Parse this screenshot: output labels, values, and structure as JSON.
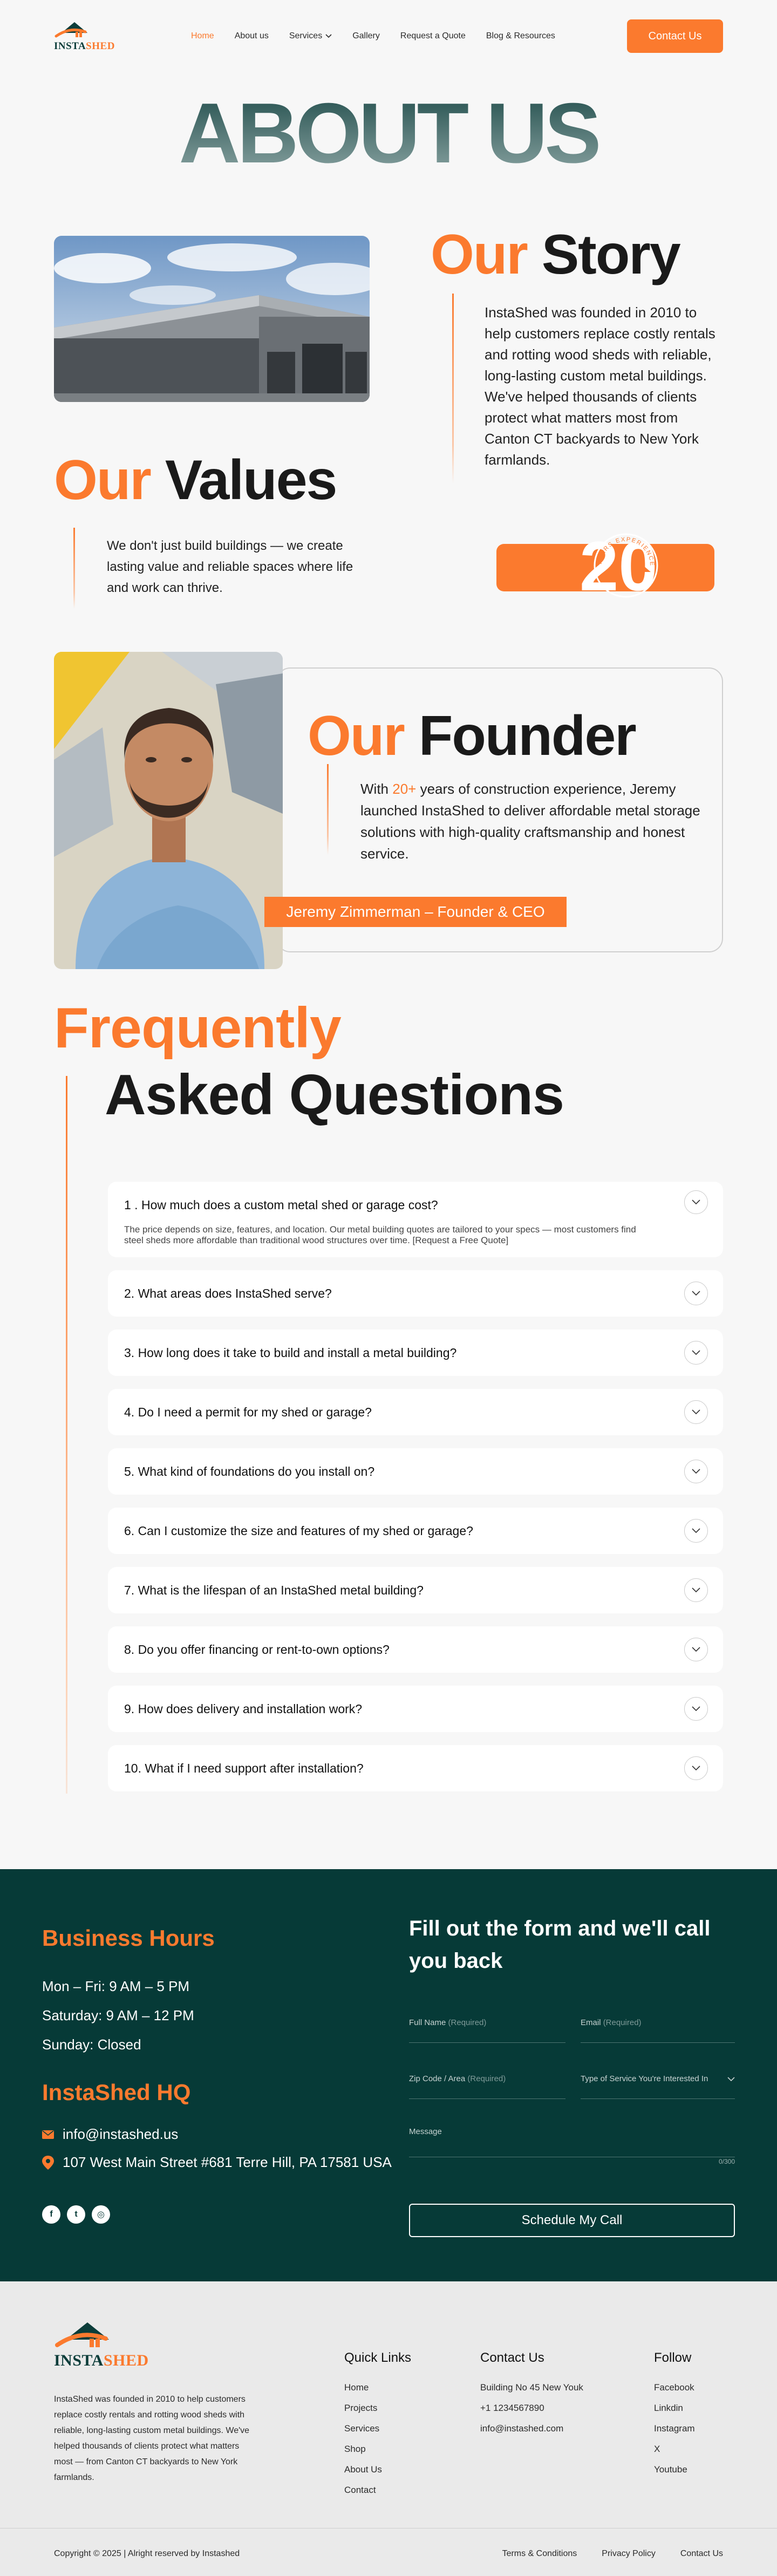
{
  "brand": {
    "word_part1": "INSTA",
    "word_part2": "SHED",
    "orange": "#fb7a2e",
    "teal": "#063a37"
  },
  "nav": {
    "items": [
      {
        "label": "Home",
        "active": true
      },
      {
        "label": "About us"
      },
      {
        "label": "Services"
      },
      {
        "label": "Gallery"
      },
      {
        "label": "Request a Quote"
      },
      {
        "label": "Blog & Resources"
      }
    ],
    "cta": "Contact Us"
  },
  "hero": {
    "title": "ABOUT US"
  },
  "story": {
    "title_accent": "Our",
    "title_main": "Story",
    "text": "InstaShed was founded in 2010 to help customers replace costly rentals and rotting wood sheds with reliable, long-lasting custom metal buildings. We've helped thousands of clients protect what matters most from Canton CT backyards to New York farmlands."
  },
  "values": {
    "title_accent": "Our",
    "title_main": "Values",
    "text": "We don't just build buildings — we create lasting value and reliable spaces where life and work can thrive.",
    "badge_number": "20",
    "badge_ring": "YEARS EXPERIENCE"
  },
  "founder": {
    "title_accent": "Our",
    "title_main": "Founder",
    "text_before": "With ",
    "text_highlight": "20+",
    "text_after": " years of construction experience, Jeremy launched InstaShed to deliver affordable metal storage solutions with high-quality craftsmanship and honest service.",
    "name_badge": "Jeremy Zimmerman – Founder & CEO"
  },
  "faq": {
    "title_line1": "Frequently",
    "title_line2": "Asked Questions",
    "items": [
      {
        "q": "1 .   How much does a custom metal shed or garage cost?",
        "a": "The price depends on size, features, and location. Our metal building quotes are tailored to your specs — most customers find steel sheds more affordable than traditional wood structures over time. [Request a Free Quote]",
        "open": true
      },
      {
        "q": "2. What areas does InstaShed serve?"
      },
      {
        "q": "3. How long does it take to build and install a metal building?"
      },
      {
        "q": "4. Do I need a permit for my shed or garage?"
      },
      {
        "q": "5. What kind of foundations do you install on?"
      },
      {
        "q": "6. Can I customize the size and features of my shed or garage?"
      },
      {
        "q": "7. What is the lifespan of an InstaShed metal building?"
      },
      {
        "q": "8. Do you offer financing or rent-to-own options?"
      },
      {
        "q": "9. How does delivery and installation work?"
      },
      {
        "q": "10. What if I need support after installation?"
      }
    ]
  },
  "contact": {
    "hours_title": "Business Hours",
    "hours": [
      "Mon – Fri: 9 AM – 5 PM",
      "Saturday: 9 AM – 12 PM",
      "Sunday: Closed"
    ],
    "hq_title": "InstaShed HQ",
    "email": "info@instashed.us",
    "address": "107 West Main Street #681 Terre Hill, PA 17581 USA",
    "form_title": "Fill out the form and we'll call you back",
    "fields": {
      "full_name": "Full Name",
      "email": "Email",
      "zip": "Zip Code / Area",
      "service": "Type of Service You're Interested In",
      "message": "Message",
      "required": "(Required)",
      "char_count": "0/300"
    },
    "submit": "Schedule My Call"
  },
  "footer": {
    "description": "InstaShed was founded in 2010 to help customers replace costly rentals and rotting wood sheds with reliable, long-lasting custom metal buildings. We've helped thousands of clients protect what matters most — from Canton CT backyards to New York farmlands.",
    "quick_links_title": "Quick Links",
    "quick_links": [
      "Home",
      "Projects",
      "Services",
      "Shop",
      "About Us",
      "Contact"
    ],
    "contact_title": "Contact Us",
    "contact_lines": [
      "Building No 45 New Youk",
      "+1 1234567890",
      "info@instashed.com"
    ],
    "follow_title": "Follow",
    "follow_links": [
      "Facebook",
      "Linkdin",
      "Instagram",
      "X",
      "Youtube"
    ],
    "copyright": "Copyright © 2025 | Alright reserved by  Instashed",
    "legal": [
      "Terms & Conditions",
      "Privacy Policy",
      "Contact Us"
    ]
  }
}
